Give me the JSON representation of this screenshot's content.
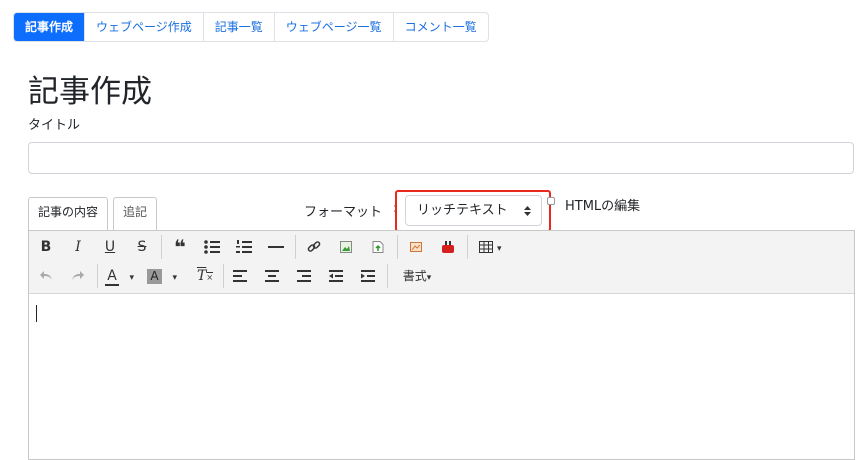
{
  "nav": {
    "tabs": [
      {
        "label": "記事作成",
        "active": true
      },
      {
        "label": "ウェブページ作成"
      },
      {
        "label": "記事一覧"
      },
      {
        "label": "ウェブページ一覧"
      },
      {
        "label": "コメント一覧"
      }
    ]
  },
  "page": {
    "title": "記事作成",
    "title_field_label": "タイトル",
    "title_value": ""
  },
  "content_tabs": {
    "content": "記事の内容",
    "append": "追記"
  },
  "format": {
    "label": "フォーマット",
    "colon": ":",
    "selected": "リッチテキスト",
    "arrows": "▲▼"
  },
  "html_edit": {
    "label": "HTMLの編集",
    "checked": false
  },
  "toolbar": {
    "bold": "B",
    "italic": "I",
    "underline": "U",
    "strike": "S",
    "quote": "❝",
    "text_color": "A",
    "bg_color": "A",
    "clear_format": "T",
    "styles_menu": "書式",
    "caret": "▾"
  },
  "colors": {
    "accent": "#0d6efd",
    "highlight": "#e8291f",
    "toolbar_bg": "#f3f3f3"
  }
}
